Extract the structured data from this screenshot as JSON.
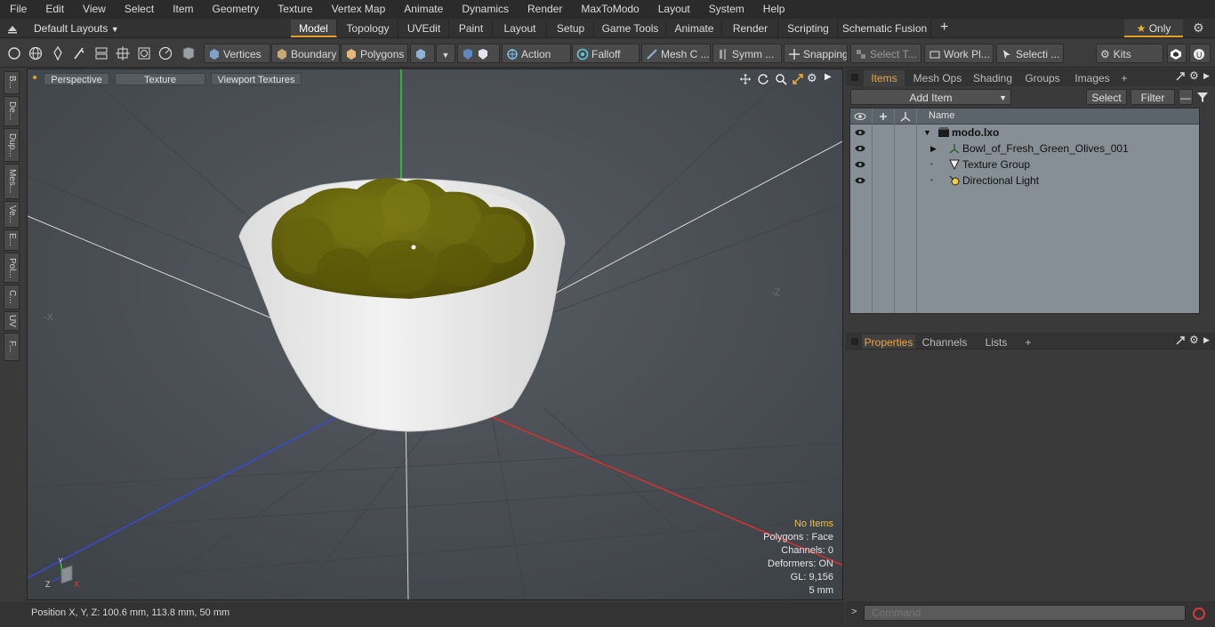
{
  "menu": [
    "File",
    "Edit",
    "View",
    "Select",
    "Item",
    "Geometry",
    "Texture",
    "Vertex Map",
    "Animate",
    "Dynamics",
    "Render",
    "MaxToModo",
    "Layout",
    "System",
    "Help"
  ],
  "layout_selector": "Default Layouts",
  "layout_tabs": [
    "Model",
    "Topology",
    "UVEdit",
    "Paint",
    "Layout",
    "Setup",
    "Game Tools",
    "Animate",
    "Render",
    "Scripting",
    "Schematic Fusion"
  ],
  "only_label": "Only",
  "toolbar": {
    "vertices": "Vertices",
    "boundary": "Boundary",
    "polygons": "Polygons",
    "action": "Action",
    "falloff": "Falloff",
    "mesh": "Mesh C ...",
    "symm": "Symm ...",
    "snapping": "Snapping",
    "select_t": "Select T...",
    "work_pl": "Work Pl...",
    "selecti": "Selecti ...",
    "kits": "Kits"
  },
  "left_tabs": [
    "B...",
    "De...",
    "Dup...",
    "Mes...",
    "Ve...",
    "E...",
    "Pol...",
    "C...",
    "UV",
    "F..."
  ],
  "viewport": {
    "tabs": [
      "Perspective",
      "Texture",
      "Viewport Textures"
    ],
    "overlay": {
      "no_items": "No Items",
      "polygons": "Polygons : Face",
      "channels": "Channels: 0",
      "deformers": "Deformers: ON",
      "gl": "GL: 9,156",
      "scale": "5 mm"
    },
    "axis_labels": {
      "y": "Y",
      "z": "Z",
      "x": "X"
    }
  },
  "status": "Position X, Y, Z:   100.6 mm, 113.8 mm, 50 mm",
  "items_panel": {
    "tabs": [
      "Items",
      "Mesh Ops",
      "Shading",
      "Groups",
      "Images"
    ],
    "add_item": "Add Item",
    "select": "Select",
    "filter": "Filter",
    "name_header": "Name",
    "rows": [
      {
        "label": "modo.lxo"
      },
      {
        "label": "Bowl_of_Fresh_Green_Olives_001"
      },
      {
        "label": "Texture Group"
      },
      {
        "label": "Directional Light"
      }
    ]
  },
  "props_panel": {
    "tabs": [
      "Properties",
      "Channels",
      "Lists"
    ]
  },
  "command_placeholder": "Command",
  "colors": {
    "accent": "#e6a02a",
    "olive": "#6b6a10",
    "bowl": "#ececec",
    "axis_x": "#d33030",
    "axis_y": "#30c030",
    "axis_z": "#3040d0"
  }
}
